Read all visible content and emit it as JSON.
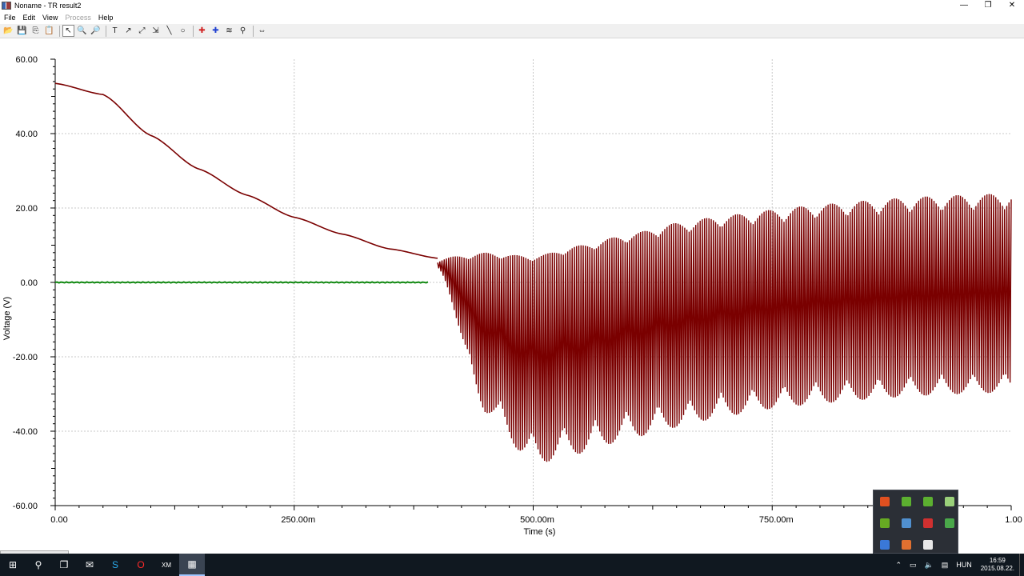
{
  "window": {
    "title": "Noname - TR result2",
    "controls": {
      "minimize": "—",
      "maximize": "❐",
      "close": "✕"
    }
  },
  "menu": {
    "items": [
      {
        "label": "File",
        "enabled": true
      },
      {
        "label": "Edit",
        "enabled": true
      },
      {
        "label": "View",
        "enabled": true
      },
      {
        "label": "Process",
        "enabled": false
      },
      {
        "label": "Help",
        "enabled": true
      }
    ]
  },
  "toolbar": {
    "buttons": [
      {
        "name": "open-icon",
        "glyph": "📂"
      },
      {
        "name": "save-icon",
        "glyph": "💾"
      },
      {
        "name": "copy-icon",
        "glyph": "⎘"
      },
      {
        "name": "paste-icon",
        "glyph": "📋"
      },
      {
        "name": "select-pointer-icon",
        "glyph": "↖",
        "active": true
      },
      {
        "name": "zoom-in-icon",
        "glyph": "🔍"
      },
      {
        "name": "zoom-out-icon",
        "glyph": "🔎"
      },
      {
        "name": "text-tool-icon",
        "glyph": "T"
      },
      {
        "name": "arrow-annotation-icon",
        "glyph": "↗"
      },
      {
        "name": "cursor-a-icon",
        "glyph": "⤢"
      },
      {
        "name": "cursor-b-icon",
        "glyph": "⇲"
      },
      {
        "name": "line-tool-icon",
        "glyph": "╲"
      },
      {
        "name": "circle-tool-icon",
        "glyph": "○"
      },
      {
        "name": "marker-red-icon",
        "glyph": "✚"
      },
      {
        "name": "marker-blue-icon",
        "glyph": "✚"
      },
      {
        "name": "curves-icon",
        "glyph": "≋"
      },
      {
        "name": "probe-icon",
        "glyph": "⚲"
      },
      {
        "name": "move-arrows-icon",
        "glyph": "⇔"
      }
    ]
  },
  "chart_data": {
    "type": "line",
    "xlabel": "Time (s)",
    "ylabel": "Voltage (V)",
    "xlim": [
      0,
      1
    ],
    "ylim": [
      -60,
      60
    ],
    "x_ticks": [
      {
        "value": 0,
        "label": "0.00"
      },
      {
        "value": 0.25,
        "label": "250.00m"
      },
      {
        "value": 0.5,
        "label": "500.00m"
      },
      {
        "value": 0.75,
        "label": "750.00m"
      },
      {
        "value": 1,
        "label": "1.00"
      }
    ],
    "y_ticks": [
      {
        "value": 60,
        "label": "60.00"
      },
      {
        "value": 40,
        "label": "40.00"
      },
      {
        "value": 20,
        "label": "20.00"
      },
      {
        "value": 0,
        "label": "0.00"
      },
      {
        "value": -20,
        "label": "-20.00"
      },
      {
        "value": -40,
        "label": "-40.00"
      },
      {
        "value": -60,
        "label": "-60.00"
      }
    ],
    "grid": true,
    "series": [
      {
        "color": "#7a0000",
        "decay": {
          "x": [
            0,
            0.05,
            0.1,
            0.15,
            0.2,
            0.25,
            0.3,
            0.35,
            0.4
          ],
          "y": [
            53.5,
            50.5,
            39.5,
            30.5,
            23.5,
            17.5,
            13,
            9,
            6.5
          ]
        },
        "oscillation": {
          "x": [
            0.4,
            0.45,
            0.5,
            0.55,
            0.6,
            0.65,
            0.7,
            0.75,
            0.8,
            0.85,
            0.9,
            0.95,
            1.0
          ],
          "upper": [
            6.5,
            8,
            7,
            10,
            13,
            16,
            18,
            19.5,
            21,
            22,
            23,
            23.5,
            24
          ],
          "lower": [
            5,
            -35,
            -49,
            -46,
            -42,
            -39,
            -36,
            -34,
            -32.5,
            -31.5,
            -30.5,
            -30,
            -29.5
          ]
        }
      },
      {
        "color": "#118811",
        "x": [
          0,
          0.39
        ],
        "y": [
          0,
          0
        ]
      }
    ]
  },
  "taskbar": {
    "apps": [
      {
        "name": "start-icon",
        "glyph": "⊞"
      },
      {
        "name": "search-icon",
        "glyph": "⚲"
      },
      {
        "name": "task-view-icon",
        "glyph": "❐"
      },
      {
        "name": "thunderbird-icon",
        "glyph": "✉"
      },
      {
        "name": "skype-icon",
        "glyph": "S"
      },
      {
        "name": "opera-icon",
        "glyph": "O"
      },
      {
        "name": "xm-app-icon",
        "glyph": "XM"
      },
      {
        "name": "tina-app-icon",
        "glyph": "▦",
        "active": true
      }
    ],
    "tray": {
      "language": "HUN",
      "time": "16:59",
      "date": "2015.08.22."
    }
  },
  "tray_popup": {
    "icons": [
      {
        "name": "ms-office-icon",
        "color": "#e05020"
      },
      {
        "name": "evernote-icon",
        "color": "#5cb030"
      },
      {
        "name": "upwork-icon",
        "color": "#5cb030"
      },
      {
        "name": "download-icon",
        "color": "#9ad07a"
      },
      {
        "name": "nvidia-icon",
        "color": "#66aa22"
      },
      {
        "name": "document-icon",
        "color": "#5090d0"
      },
      {
        "name": "pdf-icon",
        "color": "#d03030"
      },
      {
        "name": "shield-icon",
        "color": "#4aa84a"
      },
      {
        "name": "bluetooth-icon",
        "color": "#3a78d8"
      },
      {
        "name": "speaker-icon",
        "color": "#e07030"
      },
      {
        "name": "cloud-icon",
        "color": "#e8e8e8"
      }
    ]
  }
}
